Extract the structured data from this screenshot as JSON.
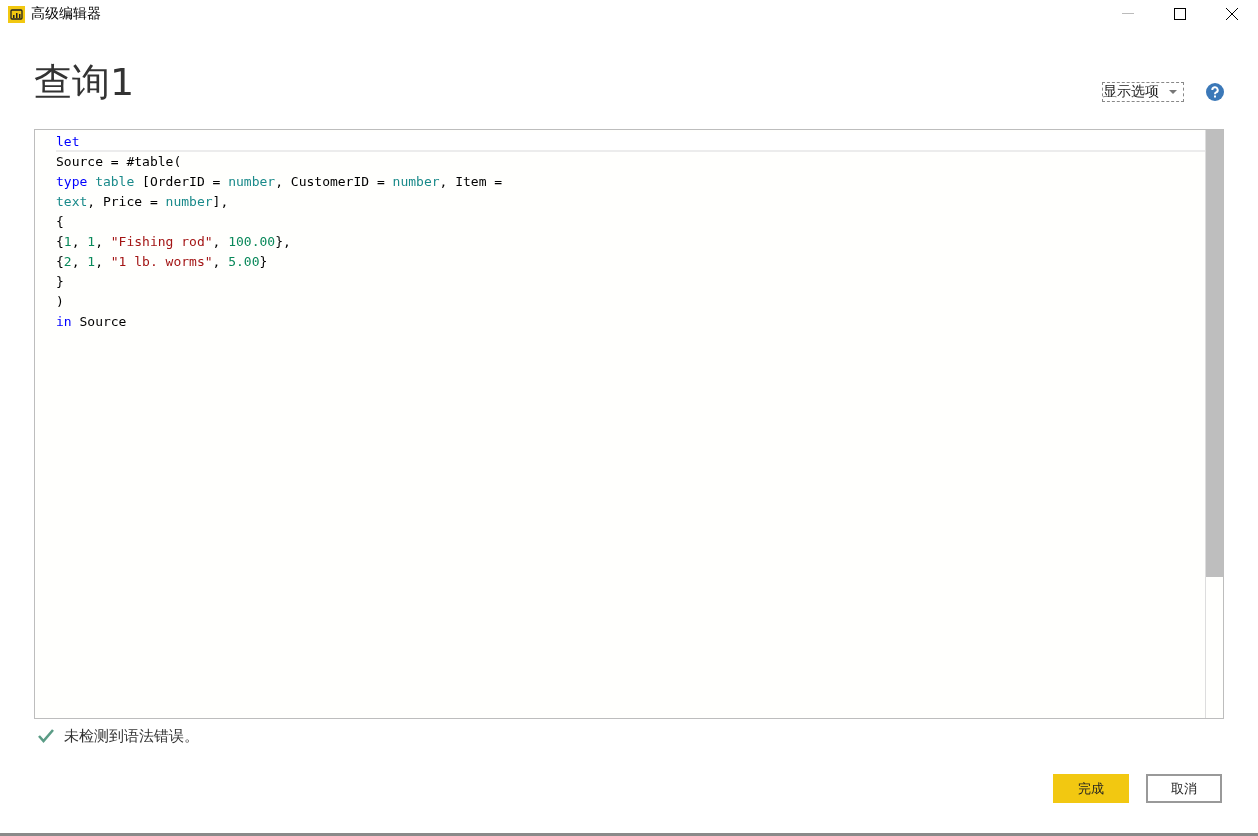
{
  "window": {
    "title": "高级编辑器"
  },
  "heading": "查询1",
  "display_options": {
    "label": "显示选项"
  },
  "editor": {
    "lines": [
      {
        "current": true,
        "tokens": [
          {
            "kind": "keyword",
            "text": "let"
          }
        ]
      },
      {
        "current": false,
        "tokens": [
          {
            "kind": "plain",
            "text": "Source = #table("
          }
        ]
      },
      {
        "current": false,
        "tokens": [
          {
            "kind": "keyword",
            "text": "type "
          },
          {
            "kind": "type",
            "text": "table"
          },
          {
            "kind": "plain",
            "text": " [OrderID = "
          },
          {
            "kind": "type",
            "text": "number"
          },
          {
            "kind": "plain",
            "text": ", CustomerID = "
          },
          {
            "kind": "type",
            "text": "number"
          },
          {
            "kind": "plain",
            "text": ", Item ="
          }
        ]
      },
      {
        "current": false,
        "tokens": [
          {
            "kind": "type",
            "text": "text"
          },
          {
            "kind": "plain",
            "text": ", Price = "
          },
          {
            "kind": "type",
            "text": "number"
          },
          {
            "kind": "plain",
            "text": "],"
          }
        ]
      },
      {
        "current": false,
        "tokens": [
          {
            "kind": "plain",
            "text": "{"
          }
        ]
      },
      {
        "current": false,
        "tokens": [
          {
            "kind": "plain",
            "text": "{"
          },
          {
            "kind": "number",
            "text": "1"
          },
          {
            "kind": "plain",
            "text": ", "
          },
          {
            "kind": "number",
            "text": "1"
          },
          {
            "kind": "plain",
            "text": ", "
          },
          {
            "kind": "string",
            "text": "\"Fishing rod\""
          },
          {
            "kind": "plain",
            "text": ", "
          },
          {
            "kind": "number",
            "text": "100.00"
          },
          {
            "kind": "plain",
            "text": "},"
          }
        ]
      },
      {
        "current": false,
        "tokens": [
          {
            "kind": "plain",
            "text": "{"
          },
          {
            "kind": "number",
            "text": "2"
          },
          {
            "kind": "plain",
            "text": ", "
          },
          {
            "kind": "number",
            "text": "1"
          },
          {
            "kind": "plain",
            "text": ", "
          },
          {
            "kind": "string",
            "text": "\"1 lb. worms\""
          },
          {
            "kind": "plain",
            "text": ", "
          },
          {
            "kind": "number",
            "text": "5.00"
          },
          {
            "kind": "plain",
            "text": "}"
          }
        ]
      },
      {
        "current": false,
        "tokens": [
          {
            "kind": "plain",
            "text": "}"
          }
        ]
      },
      {
        "current": false,
        "tokens": [
          {
            "kind": "plain",
            "text": ")"
          }
        ]
      },
      {
        "current": false,
        "tokens": [
          {
            "kind": "keyword",
            "text": "in"
          },
          {
            "kind": "plain",
            "text": " Source"
          }
        ]
      }
    ]
  },
  "status": {
    "kind": "ok",
    "text": "未检测到语法错误。"
  },
  "buttons": [
    {
      "kind": "primary",
      "label": "完成"
    },
    {
      "kind": "secondary",
      "label": "取消"
    }
  ]
}
